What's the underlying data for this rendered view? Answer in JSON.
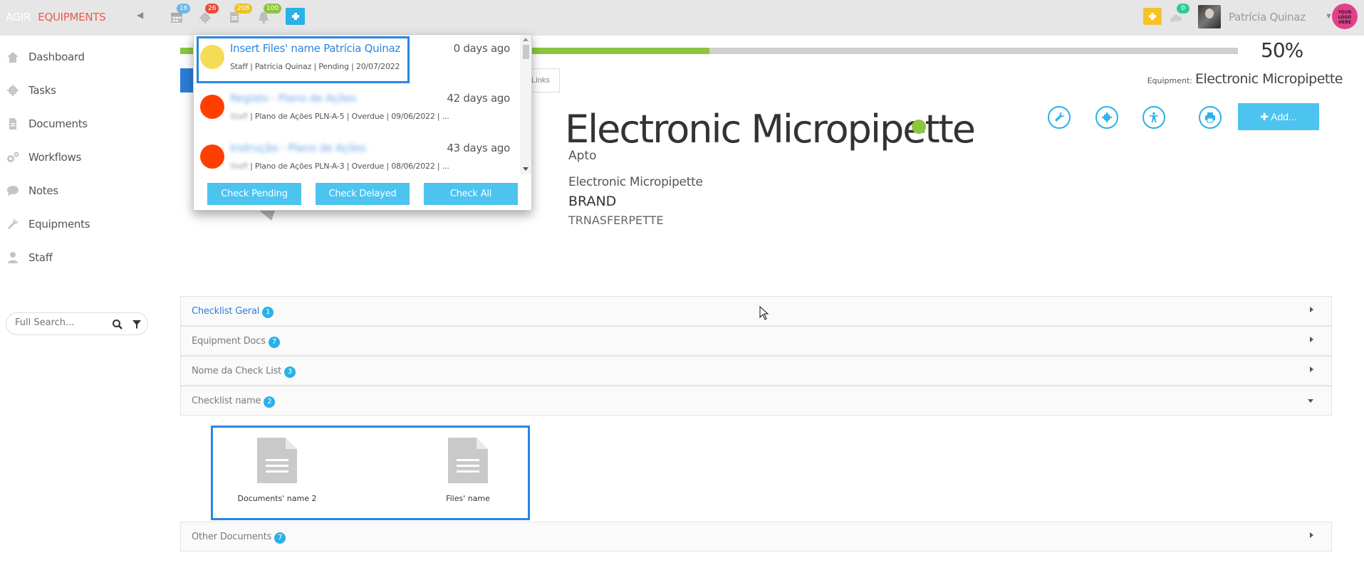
{
  "brand": {
    "part1": "AGIR",
    "part2": "EQUIPMENTS"
  },
  "topbar": {
    "badges": {
      "calendar": "16",
      "tasks": "26",
      "documents": "208",
      "notifications": "100",
      "messages": "0"
    },
    "badge_colors": {
      "calendar": "#6cb8e6",
      "tasks": "#e74c3c",
      "documents": "#f0c020",
      "notifications": "#8cc63f",
      "messages": "#2ecc9a"
    },
    "user_name": "Patrícia Quinaz",
    "logo_text": "YOUR LOGO HERE"
  },
  "sidebar": {
    "items": [
      {
        "label": "Dashboard",
        "icon": "home-icon"
      },
      {
        "label": "Tasks",
        "icon": "gear-icon"
      },
      {
        "label": "Documents",
        "icon": "document-icon"
      },
      {
        "label": "Workflows",
        "icon": "gears-icon"
      },
      {
        "label": "Notes",
        "icon": "chat-icon"
      },
      {
        "label": "Equipments",
        "icon": "wrench-icon"
      },
      {
        "label": "Staff",
        "icon": "user-icon"
      }
    ],
    "search_placeholder": "Full Search..."
  },
  "main": {
    "progress_percent": 50,
    "progress_label": "50%",
    "tab_links": "Links",
    "equipment_prefix": "Equipment:",
    "equipment_name": "Electronic Micropipette",
    "title": "Electronic Micropipette",
    "status": "Apto",
    "description": "Electronic Micropipette",
    "brand_label": "BRAND",
    "brand_value": "TRNASFERPETTE",
    "add_button": "Add...",
    "accent_color": "#4dc3f0"
  },
  "accordion": [
    {
      "label": "Checklist Geral",
      "count": "1",
      "expanded": false,
      "active": true
    },
    {
      "label": "Equipment Docs",
      "count": "7",
      "expanded": false,
      "active": false
    },
    {
      "label": "Nome da Check List",
      "count": "3",
      "expanded": false,
      "active": false
    },
    {
      "label": "Checklist name",
      "count": "2",
      "expanded": true,
      "active": false
    },
    {
      "label": "Other Documents",
      "count": "7",
      "expanded": false,
      "active": false
    }
  ],
  "files": [
    {
      "name": "Documents' name 2"
    },
    {
      "name": "Files' name"
    }
  ],
  "popup": {
    "notifications": [
      {
        "title": "Insert Files' name Patrícia Quinaz",
        "ago": "0 days ago",
        "sub": "Staff | Patrícia Quinaz | Pending | 20/07/2022",
        "dot_color": "#f4dc55",
        "blurred": false
      },
      {
        "title": "Registo - Plano de Ações",
        "ago": "42 days ago",
        "sub_hidden": "Staff",
        "sub": " | Plano de Ações PLN-A-5 | Overdue | 09/06/2022 | ...",
        "dot_color": "#ff3f00",
        "blurred": true
      },
      {
        "title": "Instrução - Plano de Ações",
        "ago": "43 days ago",
        "sub_hidden": "Staff",
        "sub": " | Plano de Ações PLN-A-3 | Overdue | 08/06/2022 | ...",
        "dot_color": "#ff3f00",
        "blurred": true
      }
    ],
    "buttons": {
      "pending": "Check Pending",
      "delayed": "Check Delayed",
      "all": "Check All"
    }
  }
}
